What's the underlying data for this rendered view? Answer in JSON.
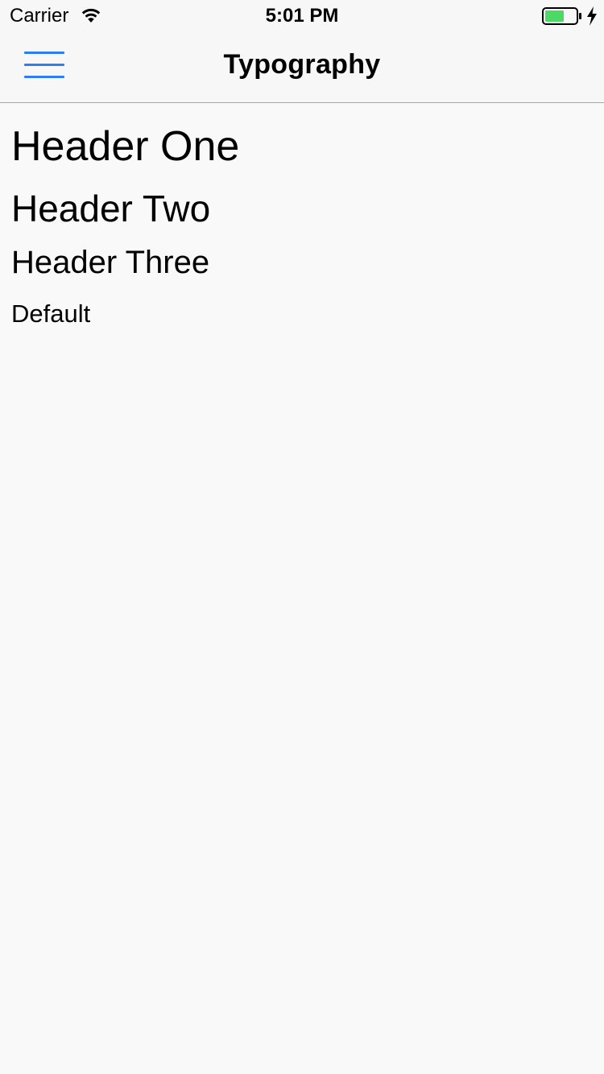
{
  "status_bar": {
    "carrier": "Carrier",
    "time": "5:01 PM",
    "battery_color": "#4cd964",
    "icons": [
      "wifi-icon",
      "battery-icon",
      "charging-icon"
    ]
  },
  "nav_bar": {
    "title": "Typography",
    "menu_icon": "hamburger-menu-icon",
    "accent_color": "#2f7df0"
  },
  "content": {
    "header_one": "Header One",
    "header_two": "Header Two",
    "header_three": "Header Three",
    "default": "Default"
  }
}
